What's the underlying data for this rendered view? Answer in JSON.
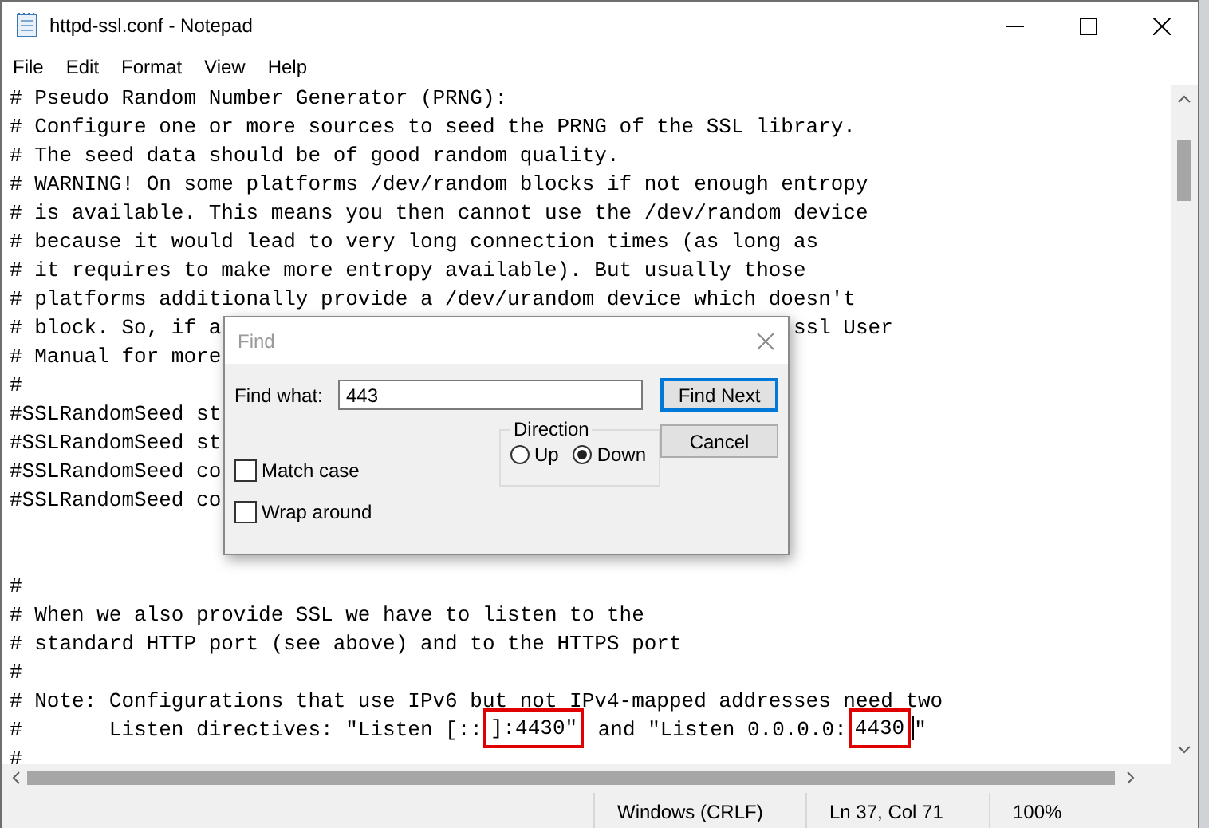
{
  "window": {
    "title": "httpd-ssl.conf - Notepad"
  },
  "menu": [
    "File",
    "Edit",
    "Format",
    "View",
    "Help"
  ],
  "editor": {
    "lines": [
      {
        "kind": "plain",
        "text": "# Pseudo Random Number Generator (PRNG):"
      },
      {
        "kind": "plain",
        "text": "# Configure one or more sources to seed the PRNG of the SSL library."
      },
      {
        "kind": "plain",
        "text": "# The seed data should be of good random quality."
      },
      {
        "kind": "plain",
        "text": "# WARNING! On some platforms /dev/random blocks if not enough entropy"
      },
      {
        "kind": "plain",
        "text": "# is available. This means you then cannot use the /dev/random device"
      },
      {
        "kind": "plain",
        "text": "# because it would lead to very long connection times (as long as"
      },
      {
        "kind": "plain",
        "text": "# it requires to make more entropy available). But usually those"
      },
      {
        "kind": "plain",
        "text": "# platforms additionally provide a /dev/urandom device which doesn't"
      },
      {
        "kind": "covered",
        "text": "# block. So, if a",
        "tail": "ssl User"
      },
      {
        "kind": "plain",
        "text": "# Manual for more"
      },
      {
        "kind": "plain",
        "text": "#"
      },
      {
        "kind": "plain",
        "text": "#SSLRandomSeed st"
      },
      {
        "kind": "plain",
        "text": "#SSLRandomSeed st"
      },
      {
        "kind": "plain",
        "text": "#SSLRandomSeed co"
      },
      {
        "kind": "plain",
        "text": "#SSLRandomSeed co"
      },
      {
        "kind": "blank"
      },
      {
        "kind": "blank"
      },
      {
        "kind": "plain",
        "text": "#"
      },
      {
        "kind": "plain",
        "text": "# When we also provide SSL we have to listen to the"
      },
      {
        "kind": "plain",
        "text": "# standard HTTP port (see above) and to the HTTPS port"
      },
      {
        "kind": "plain",
        "text": "#"
      },
      {
        "kind": "plain",
        "text": "# Note: Configurations that use IPv6 but not IPv4-mapped addresses need two"
      },
      {
        "kind": "marked",
        "segments": [
          {
            "text": "#       Listen directives: \"Listen [::",
            "highlighted": false,
            "caret": false
          },
          {
            "text": "]:4430\"",
            "highlighted": true,
            "caret": false
          },
          {
            "text": " and \"Listen 0.0.0.0:",
            "highlighted": false,
            "caret": false
          },
          {
            "text": "4430",
            "highlighted": true,
            "caret": true
          },
          {
            "text": "\"",
            "highlighted": false,
            "caret": false
          }
        ]
      },
      {
        "kind": "plain",
        "text": "#"
      }
    ]
  },
  "status_bar": {
    "line_ending": "Windows (CRLF)",
    "position": "Ln 37, Col 71",
    "zoom": "100%"
  },
  "find_dialog": {
    "title": "Find",
    "find_label": "Find what:",
    "find_value": "443",
    "buttons": [
      {
        "label": "Find Next",
        "default": true
      },
      {
        "label": "Cancel",
        "default": false
      }
    ],
    "options": [
      {
        "label": "Match case",
        "checked": false
      },
      {
        "label": "Wrap around",
        "checked": false
      }
    ],
    "direction": {
      "label": "Direction",
      "options": [
        {
          "label": "Up",
          "selected": false
        },
        {
          "label": "Down",
          "selected": true
        }
      ]
    }
  }
}
